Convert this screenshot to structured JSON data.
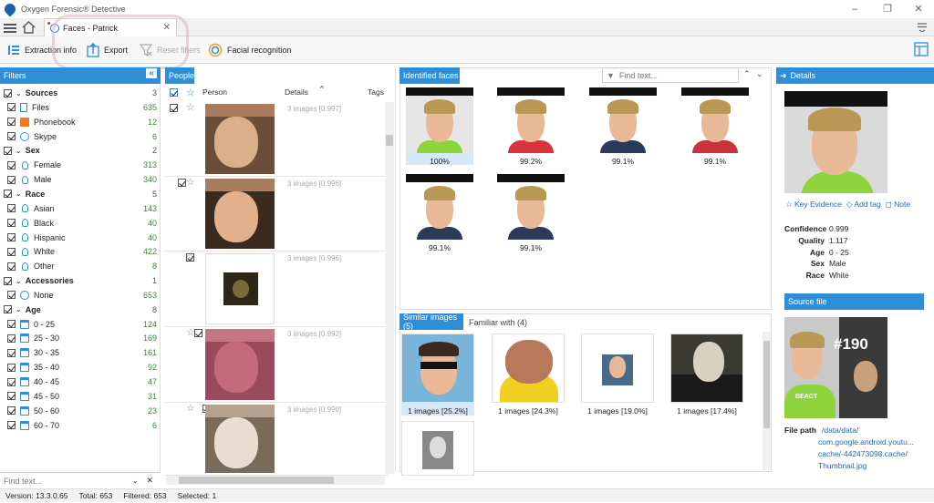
{
  "app": {
    "title": "Oxygen Forensic® Detective"
  },
  "tab": {
    "label": "Faces - Patrick"
  },
  "toolbar": {
    "extraction": "Extraction info",
    "export": "Export",
    "reset": "Reset filters",
    "facial": "Facial recognition"
  },
  "filters": {
    "header": "Filters",
    "find_placeholder": "Find text...",
    "rows": [
      {
        "label": "Sources",
        "count": "3",
        "bold": true,
        "group": true
      },
      {
        "label": "Files",
        "count": "635",
        "icon": "file-icon"
      },
      {
        "label": "Phonebook",
        "count": "12",
        "icon": "phonebook-icon"
      },
      {
        "label": "Skype",
        "count": "6",
        "icon": "skype-icon"
      },
      {
        "label": "Sex",
        "count": "2",
        "bold": true,
        "group": true
      },
      {
        "label": "Female",
        "count": "313",
        "icon": "female-icon"
      },
      {
        "label": "Male",
        "count": "340",
        "icon": "male-icon"
      },
      {
        "label": "Race",
        "count": "5",
        "bold": true,
        "group": true
      },
      {
        "label": "Asian",
        "count": "143",
        "icon": "person-icon"
      },
      {
        "label": "Black",
        "count": "40",
        "icon": "person-icon"
      },
      {
        "label": "Hispanic",
        "count": "40",
        "icon": "person-icon"
      },
      {
        "label": "White",
        "count": "422",
        "icon": "person-icon"
      },
      {
        "label": "Other",
        "count": "8",
        "icon": "person-icon"
      },
      {
        "label": "Accessories",
        "count": "1",
        "bold": true,
        "group": true
      },
      {
        "label": "None",
        "count": "653",
        "icon": "circle-icon"
      },
      {
        "label": "Age",
        "count": "8",
        "bold": true,
        "group": true
      },
      {
        "label": "0 - 25",
        "count": "124",
        "icon": "calendar-icon"
      },
      {
        "label": "25 - 30",
        "count": "169",
        "icon": "calendar-icon"
      },
      {
        "label": "30 - 35",
        "count": "161",
        "icon": "calendar-icon"
      },
      {
        "label": "35 - 40",
        "count": "92",
        "icon": "calendar-icon"
      },
      {
        "label": "40 - 45",
        "count": "47",
        "icon": "calendar-icon"
      },
      {
        "label": "45 - 50",
        "count": "31",
        "icon": "calendar-icon"
      },
      {
        "label": "50 - 60",
        "count": "23",
        "icon": "calendar-icon"
      },
      {
        "label": "60 - 70",
        "count": "6",
        "icon": "calendar-icon"
      }
    ]
  },
  "people": {
    "header": "People",
    "col_person": "Person",
    "col_details": "Details",
    "col_tags": "Tags",
    "rows": [
      {
        "details": "3 images [0.997]"
      },
      {
        "details": "3 images [0.996]"
      },
      {
        "details": "3 images [0.996]"
      },
      {
        "details": "3 images [0.992]"
      },
      {
        "details": "3 images [0.990]"
      }
    ]
  },
  "identified": {
    "header": "Identified faces",
    "find_placeholder": "Find text...",
    "faces": [
      "100%",
      "99.2%",
      "99.1%",
      "99.1%",
      "99.1%",
      "99.1%"
    ]
  },
  "similar": {
    "tab1": "Similar images (5)",
    "tab2": "Familiar with (4)",
    "items": [
      "1 images [25.2%]",
      "1 images [24.3%]",
      "1 images [19.0%]",
      "1 images [17.4%]"
    ]
  },
  "details": {
    "header": "Details",
    "key_evidence": "Key Evidence",
    "add_tag": "Add tag",
    "note": "Note",
    "fields": [
      {
        "k": "Confidence",
        "v": "0.999"
      },
      {
        "k": "Quality",
        "v": "1.117"
      },
      {
        "k": "Age",
        "v": "0 - 25"
      },
      {
        "k": "Sex",
        "v": "Male"
      },
      {
        "k": "Race",
        "v": "White"
      }
    ],
    "source_file": "Source file",
    "thumb_text": "#190",
    "thumb_shirt": "BEACT",
    "file_path_label": "File path",
    "file_path": [
      "/data/data/",
      "com.google.android.youtu...",
      "cache/-442473098.cache/",
      "Thumbnail.jpg"
    ]
  },
  "status": {
    "version": "Version: 13.3.0.65",
    "total": "Total: 653",
    "filtered": "Filtered: 653",
    "selected": "Selected: 1"
  }
}
